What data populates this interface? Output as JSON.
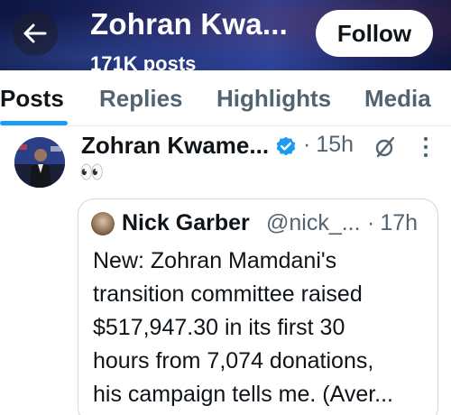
{
  "header": {
    "title": "Zohran Kwa...",
    "subtitle": "171K posts",
    "follow_label": "Follow",
    "back_icon": "arrow-left-icon"
  },
  "tabs": [
    {
      "label": "Posts",
      "active": true
    },
    {
      "label": "Replies",
      "active": false
    },
    {
      "label": "Highlights",
      "active": false
    },
    {
      "label": "Media",
      "active": false
    }
  ],
  "post": {
    "author": "Zohran Kwame...",
    "separator": "·",
    "time": "15h",
    "text": "👀",
    "verified": true,
    "icons": [
      "verified-badge-icon",
      "grok-icon",
      "more-icon"
    ]
  },
  "quote": {
    "author": "Nick Garber",
    "handle": "@nick_...",
    "separator": "·",
    "time": "17h",
    "lines": [
      "New: Zohran Mamdani's",
      "transition committee raised",
      "$517,947.30 in its first 30",
      "hours from 7,074 donations,",
      "his campaign tells me. (Aver..."
    ]
  },
  "colors": {
    "accent": "#1d9bf0",
    "muted": "#536471",
    "text": "#0f1419",
    "header_bg": "#1d2a6e"
  }
}
